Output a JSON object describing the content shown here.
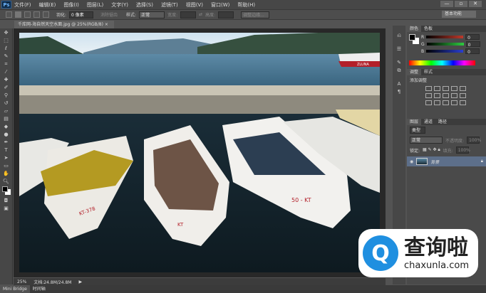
{
  "app": {
    "logo": "Ps"
  },
  "menu": [
    "文件(F)",
    "编辑(E)",
    "图像(I)",
    "图层(L)",
    "文字(Y)",
    "选择(S)",
    "滤镜(T)",
    "视图(V)",
    "窗口(W)",
    "帮助(H)"
  ],
  "window_buttons": [
    "—",
    "▫",
    "✕"
  ],
  "options": {
    "feather_label": "羽化:",
    "feather_value": "0 像素",
    "antialias": "消除锯齿",
    "style_label": "样式:",
    "style_value": "正常",
    "width_label": "宽度:",
    "height_label": "高度:",
    "refine_edge": "调整边缘..."
  },
  "workspace": "基本功能",
  "document_tab": "千库网-海自然天空水面.jpg @ 25%(RGB/8) ×",
  "status": {
    "zoom": "25%",
    "doc": "文档:24.8M/24.8M"
  },
  "bottom_tabs": [
    "Mini Bridge",
    "时间轴"
  ],
  "color_panel": {
    "tabs": [
      "颜色",
      "色板"
    ],
    "channels": [
      {
        "label": "R",
        "value": "0",
        "color": "#c0392b"
      },
      {
        "label": "G",
        "value": "0",
        "color": "#2ecc40"
      },
      {
        "label": "B",
        "value": "0",
        "color": "#2a3fd0"
      }
    ]
  },
  "adjust_panel": {
    "tabs": [
      "调整",
      "样式"
    ],
    "hint": "添加调整"
  },
  "layers_panel": {
    "tabs": [
      "图层",
      "通道",
      "路径"
    ],
    "kind": "类型",
    "blend": "正常",
    "opacity_label": "不透明度:",
    "opacity": "100%",
    "lock_label": "锁定:",
    "fill_label": "填充:",
    "fill": "100%",
    "layers": [
      {
        "name": "背景"
      }
    ]
  },
  "watermark": {
    "brand": "查询啦",
    "url": "chaxunla.com"
  },
  "photo": {
    "boat_labels": [
      "KT-378",
      "50 - KT",
      "ZLUNA"
    ]
  }
}
